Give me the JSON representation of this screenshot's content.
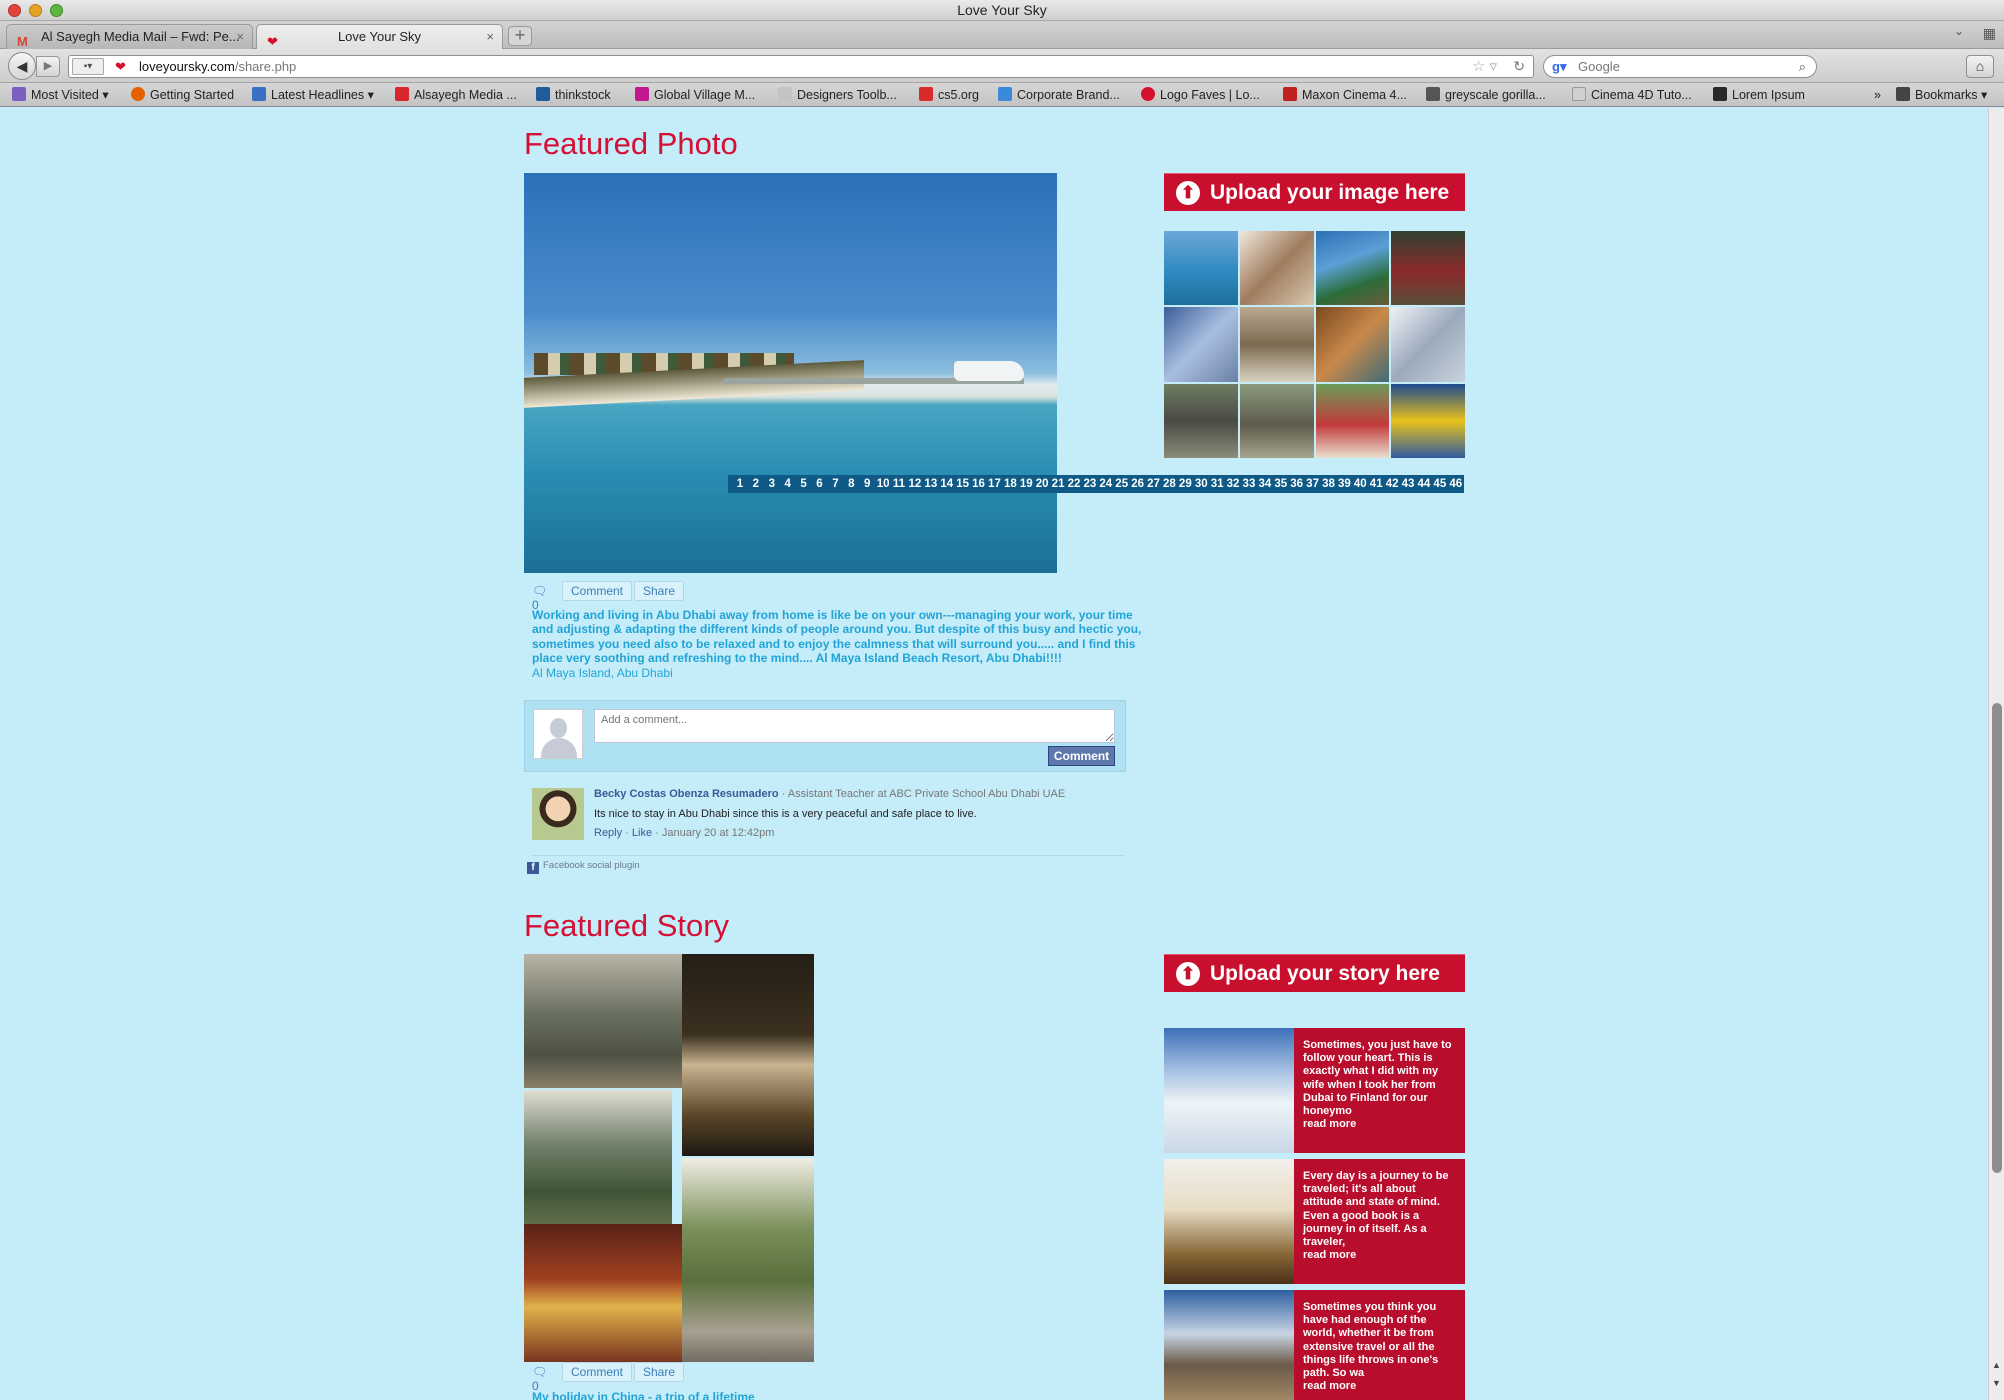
{
  "window": {
    "title": "Love Your Sky"
  },
  "tabs": [
    {
      "label": "Al Sayegh Media Mail – Fwd: Pe...",
      "icon": "gmail-icon",
      "active": false
    },
    {
      "label": "Love Your Sky",
      "icon": "heart-icon",
      "active": true
    }
  ],
  "nav": {
    "url_host": "loveyoursky.com",
    "url_path": "/share.php",
    "search_placeholder": "Google"
  },
  "bookmarks": [
    {
      "label": "Most Visited",
      "color": "#7a5ec2"
    },
    {
      "label": "Getting Started",
      "color": "#e66000"
    },
    {
      "label": "Latest Headlines",
      "color": "#3a6fc4"
    },
    {
      "label": "Alsayegh Media ...",
      "color": "#d7262d"
    },
    {
      "label": "thinkstock",
      "color": "#1f5c9a"
    },
    {
      "label": "Global Village M...",
      "color": "#c2188d"
    },
    {
      "label": "Designers Toolb...",
      "color": "#c4c4c4"
    },
    {
      "label": "cs5.org",
      "color": "#d92b2b"
    },
    {
      "label": "Corporate Brand...",
      "color": "#3b8ad9"
    },
    {
      "label": "Logo Faves | Lo...",
      "color": "#d6102c"
    },
    {
      "label": "Maxon Cinema 4...",
      "color": "#c02020"
    },
    {
      "label": "greyscale gorilla...",
      "color": "#555555"
    },
    {
      "label": "Cinema 4D Tuto...",
      "color": "#d0d0d0"
    },
    {
      "label": "Lorem Ipsum",
      "color": "#2a2a2a"
    },
    {
      "label": "Bookmarks",
      "color": "#444444"
    }
  ],
  "featured_photo": {
    "title": "Featured Photo",
    "upload_label": "Upload your image here",
    "pages": [
      "1",
      "2",
      "3",
      "4",
      "5",
      "6",
      "7",
      "8",
      "9",
      "10",
      "11",
      "12",
      "13",
      "14",
      "15",
      "16",
      "17",
      "18",
      "19",
      "20",
      "21",
      "22",
      "23",
      "24",
      "25",
      "26",
      "27",
      "28",
      "29",
      "30",
      "31",
      "32",
      "33",
      "34",
      "35",
      "36",
      "37",
      "38",
      "39",
      "40",
      "41",
      "42",
      "43",
      "44",
      "45",
      "46"
    ],
    "comment_count": "0",
    "comment_label": "Comment",
    "share_label": "Share",
    "caption": "Working and living in Abu Dhabi away from home is like be on your own---managing your work, your time and adjusting & adapting the different kinds of people around you. But despite of this busy and hectic you, sometimes you need also to be relaxed and to enjoy the calmness that will surround you..... and I find this place very soothing and refreshing to the mind.... Al Maya Island Beach Resort, Abu Dhabi!!!!",
    "location": "Al Maya Island, Abu Dhabi"
  },
  "comments_plugin": {
    "input_placeholder": "Add a comment...",
    "submit_label": "Comment",
    "comment": {
      "author": "Becky Costas Obenza Resumadero",
      "role": " · Assistant Teacher at ABC Private School Abu Dhabi UAE",
      "body": "Its nice to stay in Abu Dhabi since this is a very peaceful and safe place to live.",
      "reply": "Reply",
      "like": "Like",
      "timestamp": " · January 20 at 12:42pm"
    },
    "footer": "Facebook social plugin"
  },
  "featured_story": {
    "title": "Featured Story",
    "upload_label": "Upload your story here",
    "comment_count": "0",
    "comment_label": "Comment",
    "share_label": "Share",
    "caption": "My holiday in China - a trip of a lifetime",
    "stories": [
      {
        "text": "Sometimes, you just have to follow your heart. This is exactly what I did with my wife when I took her from Dubai to Finland for our honeymo",
        "more": "read more"
      },
      {
        "text": "Every day is a journey to be traveled; it's all about attitude and state of mind. Even a good book is a journey in of itself. As a traveler,",
        "more": "read more"
      },
      {
        "text": "Sometimes you think you have had enough of the world, whether it be from extensive travel or all the things life throws in one's path. So wa",
        "more": "read more"
      }
    ]
  },
  "colors": {
    "page_bg": "#c4ecf9",
    "accent_red": "#d51034",
    "link_blue": "#22a4d6",
    "pager_blue": "#0f5a86"
  }
}
